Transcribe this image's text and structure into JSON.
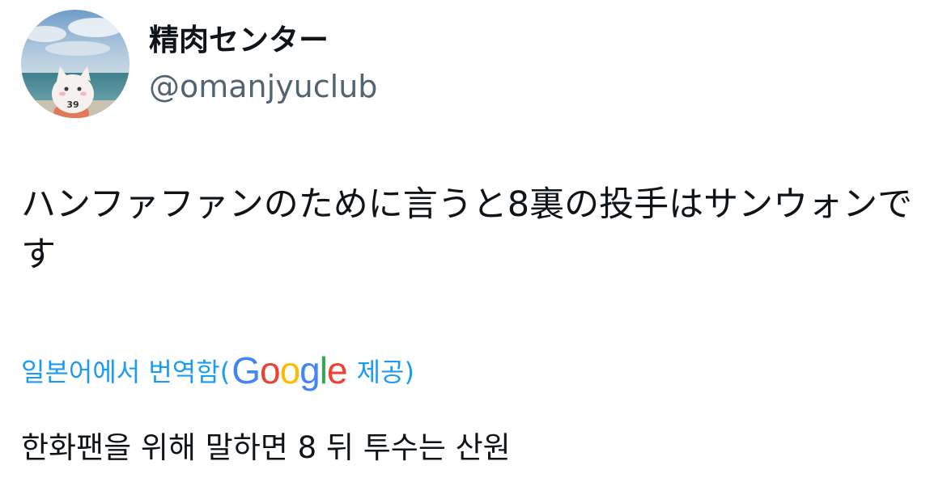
{
  "author": {
    "display_name": "精肉センター",
    "handle": "@omanjyuclub",
    "avatar_badge": "39"
  },
  "tweet": {
    "text": "ハンファファンのために言うと8裏の投手はサンウォンです"
  },
  "translation": {
    "label_prefix": "일본어에서 번역함(",
    "provider_letters": [
      "G",
      "o",
      "o",
      "g",
      "l",
      "e"
    ],
    "provider_colors": [
      "#4285F4",
      "#EA4335",
      "#FBBC05",
      "#4285F4",
      "#34A853",
      "#EA4335"
    ],
    "label_suffix": "제공)",
    "text": "한화팬을 위해 말하면 8 뒤 투수는 산원"
  },
  "colors": {
    "link": "#1d9bf0",
    "secondary_text": "#536471",
    "primary_text": "#0f1419"
  }
}
